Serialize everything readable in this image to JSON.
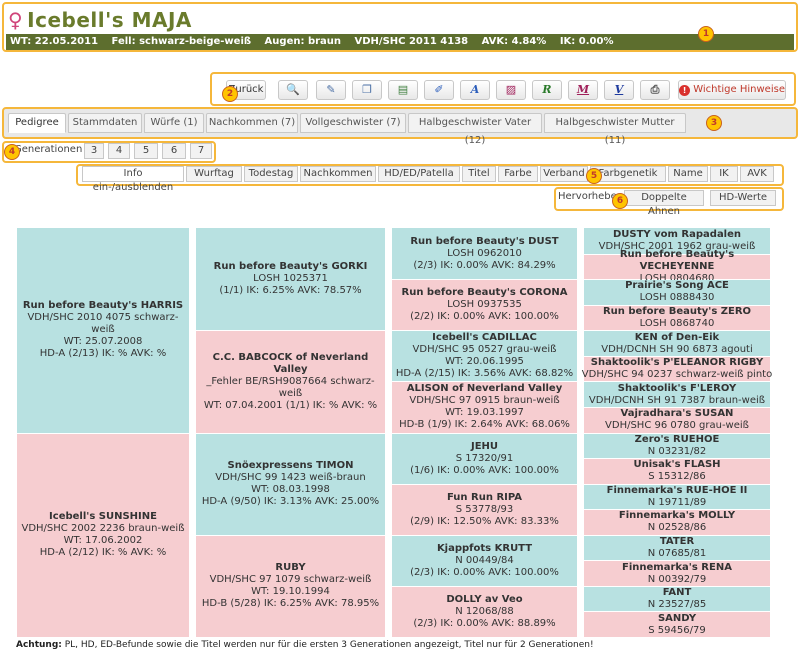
{
  "header": {
    "sex_symbol": "♀",
    "dog_name": "Icebell's MAJA",
    "info": [
      "WT: 22.05.2011",
      "Fell: schwarz-beige-weiß",
      "Augen: braun",
      "VDH/SHC 2011 4138",
      "AVK: 4.84%",
      "IK: 0.00%"
    ]
  },
  "markers": [
    "1",
    "2",
    "3",
    "4",
    "5",
    "6"
  ],
  "toolbar": {
    "back_label": "Zurück",
    "important_label": "Wichtige Hinweise",
    "icons": [
      "search-icon",
      "edit-icon",
      "copy-icon",
      "save-icon",
      "brush-icon",
      "text-a-icon",
      "chart-icon",
      "r-icon",
      "m-icon",
      "v-icon",
      "print-icon",
      "warning-icon"
    ],
    "glyphs": {
      "search": "🔍",
      "edit": "✎",
      "copy": "❐",
      "save": "▤",
      "brush": "✐",
      "a": "A",
      "chart": "▨",
      "r": "R",
      "m": "M",
      "v": "V",
      "print": "⎙",
      "warn": "!"
    },
    "colors": {
      "a": "#2b5dbb",
      "r": "#2a7a2a",
      "m": "#a0205a",
      "v": "#1f3b9e",
      "warn": "#d9302c"
    }
  },
  "tabs": [
    "Pedigree",
    "Stammdaten",
    "Würfe (1)",
    "Nachkommen (7)",
    "Vollgeschwister (7)",
    "Halbgeschwister Vater (12)",
    "Halbgeschwister Mutter (11)"
  ],
  "generations": {
    "label": "Generationen",
    "options": [
      "3",
      "4",
      "5",
      "6",
      "7"
    ]
  },
  "info_toggles": [
    "Info ein-/ausblenden",
    "Wurftag",
    "Todestag",
    "Nachkommen",
    "HD/ED/Patella",
    "Titel",
    "Farbe",
    "Verband",
    "Farbgenetik",
    "Name",
    "IK",
    "AVK"
  ],
  "highlight": {
    "label": "Hervorheben:",
    "options": [
      "Doppelte Ahnen",
      "HD-Werte"
    ]
  },
  "colors": {
    "male": "#b8e1e1",
    "female": "#f6cdd0",
    "header_bar": "#5d6e2e",
    "title": "#6a7b2c",
    "highlight_border": "#f5b73b"
  },
  "pedigree": {
    "g1": [
      {
        "name": "Run before Beauty's HARRIS",
        "lines": [
          "VDH/SHC 2010 4075   schwarz-weiß",
          "WT: 25.07.2008",
          "HD-A (2/13) IK: %  AVK: %"
        ]
      },
      {
        "name": "Icebell's SUNSHINE",
        "lines": [
          "VDH/SHC 2002 2236   braun-weiß",
          "WT: 17.06.2002",
          "HD-A (2/12) IK: %  AVK: %"
        ]
      }
    ],
    "g2": [
      {
        "name": "Run before Beauty's GORKI",
        "lines": [
          "LOSH 1025371",
          "(1/1) IK: 6.25%  AVK: 78.57%"
        ]
      },
      {
        "name": "C.C. BABCOCK of Neverland Valley",
        "lines": [
          "_Fehler BE/RSH9087664   schwarz-weiß",
          "WT: 07.04.2001   (1/1) IK: %  AVK: %"
        ]
      },
      {
        "name": "Snöexpressens TIMON",
        "lines": [
          "VDH/SHC 99 1423   weiß-braun",
          "WT: 08.03.1998",
          "HD-A (9/50) IK: 3.13%  AVK: 25.00%"
        ]
      },
      {
        "name": "RUBY",
        "lines": [
          "VDH/SHC 97 1079   schwarz-weiß",
          "WT: 19.10.1994",
          "HD-B (5/28) IK: 6.25%  AVK: 78.95%"
        ]
      }
    ],
    "g3": [
      {
        "name": "Run before Beauty's DUST",
        "lines": [
          "LOSH 0962010",
          "(2/3) IK: 0.00%  AVK: 84.29%"
        ]
      },
      {
        "name": "Run before Beauty's CORONA",
        "lines": [
          "LOSH 0937535",
          "(2/2) IK: 0.00%  AVK: 100.00%"
        ]
      },
      {
        "name": "Icebell's CADILLAC",
        "lines": [
          "VDH/SHC 95 0527   grau-weiß",
          "WT: 20.06.1995",
          "HD-A (2/15) IK: 3.56%  AVK: 68.82%"
        ]
      },
      {
        "name": "ALISON of Neverland Valley",
        "lines": [
          "VDH/SHC 97 0915   braun-weiß",
          "WT: 19.03.1997",
          "HD-B (1/9) IK: 2.64%  AVK: 68.06%"
        ]
      },
      {
        "name": "JEHU",
        "lines": [
          "S 17320/91",
          "(1/6) IK: 0.00%  AVK: 100.00%"
        ]
      },
      {
        "name": "Fun Run RIPA",
        "lines": [
          "S 53778/93",
          "(2/9) IK: 12.50%  AVK: 83.33%"
        ]
      },
      {
        "name": "Kjappfots KRUTT",
        "lines": [
          "N 00449/84",
          "(2/3) IK: 0.00%  AVK: 100.00%"
        ]
      },
      {
        "name": "DOLLY av Veo",
        "lines": [
          "N 12068/88",
          "(2/3) IK: 0.00%  AVK: 88.89%"
        ]
      }
    ],
    "g4": [
      {
        "name": "DUSTY vom Rapadalen",
        "lines": [
          "VDH/SHC 2001 1962   grau-weiß"
        ]
      },
      {
        "name": "Run before Beauty's VECHEYENNE",
        "lines": [
          "LOSH 0804680"
        ]
      },
      {
        "name": "Prairie's Song ACE",
        "lines": [
          "LOSH 0888430"
        ]
      },
      {
        "name": "Run before Beauty's ZERO",
        "lines": [
          "LOSH 0868740"
        ]
      },
      {
        "name": "KEN of Den-Eik",
        "lines": [
          "VDH/DCNH SH 90 6873   agouti"
        ]
      },
      {
        "name": "Shaktoolik's P'ELEANOR RIGBY",
        "lines": [
          "VDH/SHC 94 0237   schwarz-weiß pinto"
        ]
      },
      {
        "name": "Shaktoolik's F'LEROY",
        "lines": [
          "VDH/DCNH SH 91 7387   braun-weiß"
        ]
      },
      {
        "name": "Vajradhara's SUSAN",
        "lines": [
          "VDH/SHC 96 0780   grau-weiß"
        ]
      },
      {
        "name": "Zero's RUEHOE",
        "lines": [
          "N 03231/82"
        ]
      },
      {
        "name": "Unisak's FLASH",
        "lines": [
          "S 15312/86"
        ]
      },
      {
        "name": "Finnemarka's RUE-HOE II",
        "lines": [
          "N 19711/89"
        ]
      },
      {
        "name": "Finnemarka's MOLLY",
        "lines": [
          "N 02528/86"
        ]
      },
      {
        "name": "TATER",
        "lines": [
          "N 07685/81"
        ]
      },
      {
        "name": "Finnemarka's RENA",
        "lines": [
          "N 00392/79"
        ]
      },
      {
        "name": "FANT",
        "lines": [
          "N 23527/85"
        ]
      },
      {
        "name": "SANDY",
        "lines": [
          "S 59456/79"
        ]
      }
    ]
  },
  "footnote": {
    "bold": "Achtung:",
    "text": " PL, HD, ED-Befunde sowie die Titel werden nur für die ersten 3 Generationen angezeigt, Titel nur für 2 Generationen!"
  }
}
